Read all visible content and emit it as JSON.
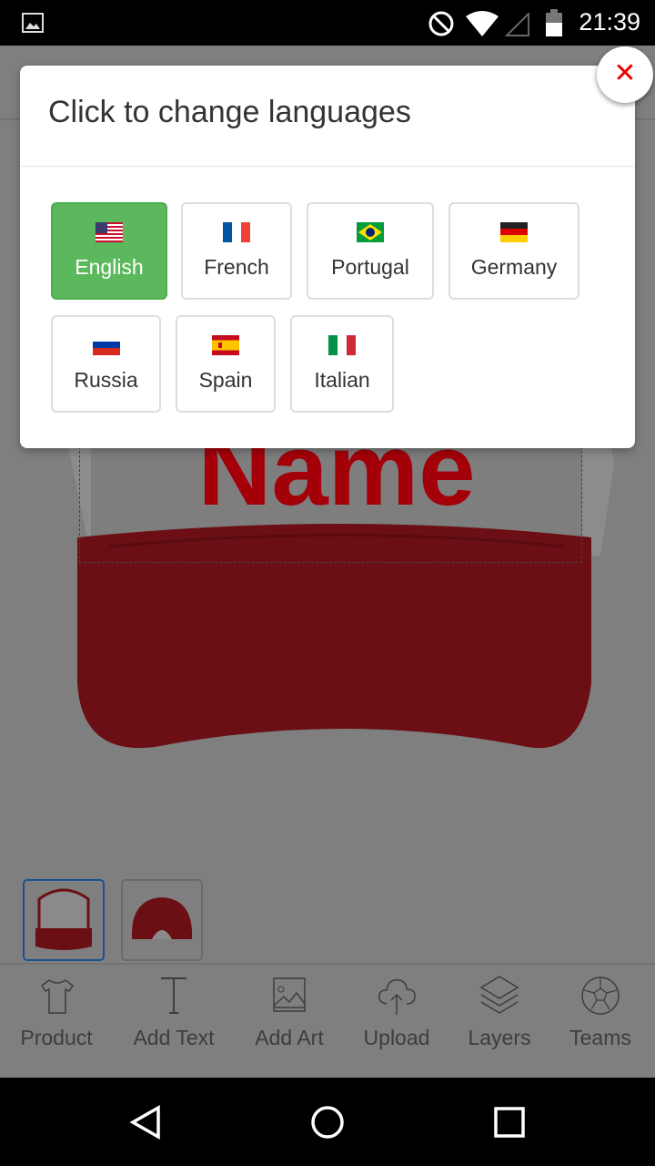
{
  "status_bar": {
    "time": "21:39",
    "icons": [
      "image-icon",
      "dnd-icon",
      "wifi-icon",
      "signal-icon",
      "battery-icon"
    ]
  },
  "canvas": {
    "design_text": "Name",
    "design_color": "#cc0011"
  },
  "thumbnails": [
    {
      "label": "front"
    },
    {
      "label": "back"
    }
  ],
  "toolbar": [
    {
      "label": "Product",
      "icon": "tshirt-icon"
    },
    {
      "label": "Add Text",
      "icon": "text-icon"
    },
    {
      "label": "Add Art",
      "icon": "image-icon"
    },
    {
      "label": "Upload",
      "icon": "cloud-upload-icon"
    },
    {
      "label": "Layers",
      "icon": "layers-icon"
    },
    {
      "label": "Teams",
      "icon": "soccer-ball-icon"
    }
  ],
  "modal": {
    "title": "Click to change languages",
    "close_icon": "close-icon",
    "accent": "#5cb85c",
    "languages": [
      {
        "label": "English",
        "flag": "us",
        "active": true
      },
      {
        "label": "French",
        "flag": "fr"
      },
      {
        "label": "Portugal",
        "flag": "br"
      },
      {
        "label": "Germany",
        "flag": "de"
      },
      {
        "label": "Russia",
        "flag": "ru"
      },
      {
        "label": "Spain",
        "flag": "es"
      },
      {
        "label": "Italian",
        "flag": "it"
      }
    ]
  }
}
